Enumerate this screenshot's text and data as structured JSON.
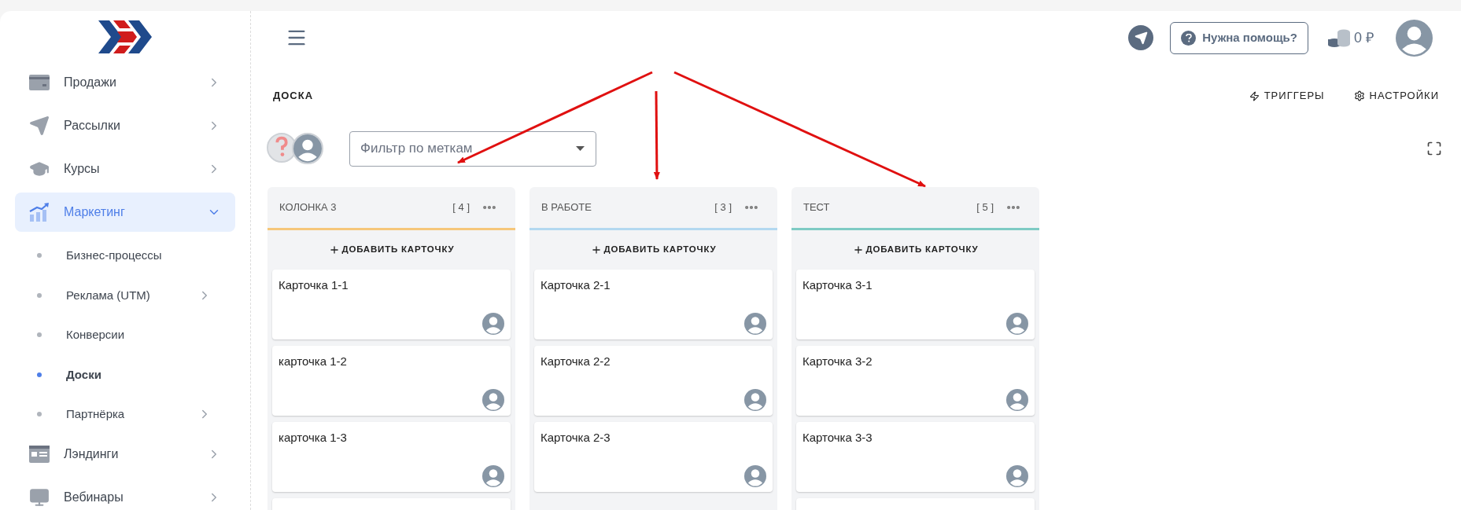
{
  "sidebar": {
    "items": [
      {
        "label": "Продажи",
        "selected": false,
        "expanded": false
      },
      {
        "label": "Рассылки",
        "selected": false,
        "expanded": false
      },
      {
        "label": "Курсы",
        "selected": false,
        "expanded": false
      },
      {
        "label": "Маркетинг",
        "selected": true,
        "expanded": true,
        "children": [
          {
            "label": "Бизнес-процессы",
            "kind": "link",
            "selected": false
          },
          {
            "label": "Реклама (UTM)",
            "kind": "group",
            "selected": false
          },
          {
            "label": "Конверсии",
            "kind": "link",
            "selected": false
          },
          {
            "label": "Доски",
            "kind": "link",
            "selected": true
          },
          {
            "label": "Партнёрка",
            "kind": "group",
            "selected": false
          }
        ]
      },
      {
        "label": "Лэндинги",
        "selected": false,
        "expanded": false
      },
      {
        "label": "Вебинары",
        "selected": false,
        "expanded": false
      }
    ]
  },
  "header": {
    "help_button": "Нужна помощь?",
    "balance": "0 ₽"
  },
  "board": {
    "title": "ДОСКА",
    "actions": [
      "ТРИГГЕРЫ",
      "НАСТРОЙКИ"
    ],
    "filter": {
      "placeholder": "Фильтр по меткам"
    },
    "columns": [
      {
        "title": "КОЛОНКА 3",
        "count": "[ 4 ]",
        "color": "#f6c77a",
        "add_label": "ДОБАВИТЬ КАРТОЧКУ",
        "more_below": true,
        "cards": [
          {
            "title": "Карточка 1-1"
          },
          {
            "title": "карточка 1-2"
          },
          {
            "title": "карточка 1-3"
          }
        ]
      },
      {
        "title": "В РАБОТЕ",
        "count": "[ 3 ]",
        "color": "#b3d8f0",
        "add_label": "ДОБАВИТЬ КАРТОЧКУ",
        "more_below": false,
        "cards": [
          {
            "title": "Карточка 2-1"
          },
          {
            "title": "Карточка 2-2"
          },
          {
            "title": "Карточка 2-3"
          }
        ]
      },
      {
        "title": "ТЕСТ",
        "count": "[ 5 ]",
        "color": "#7ecbc4",
        "add_label": "ДОБАВИТЬ КАРТОЧКУ",
        "more_below": true,
        "cards": [
          {
            "title": "Карточка 3-1"
          },
          {
            "title": "Карточка 3-2"
          },
          {
            "title": "Карточка 3-3"
          }
        ]
      }
    ]
  }
}
